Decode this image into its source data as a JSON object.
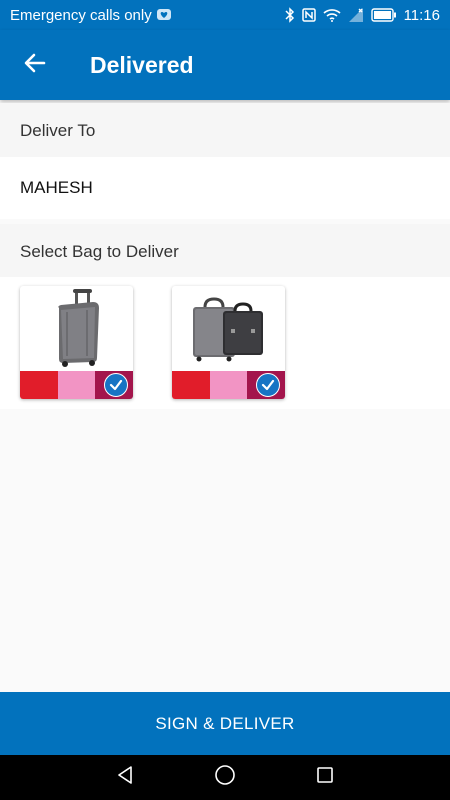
{
  "status_bar": {
    "carrier_text": "Emergency calls only",
    "time": "11:16",
    "icons": [
      "notification-icon",
      "bluetooth-icon",
      "nfc-icon",
      "wifi-icon",
      "signal-icon",
      "battery-icon"
    ]
  },
  "app_bar": {
    "back_icon": "arrow-left-icon",
    "title": "Delivered"
  },
  "deliver_to": {
    "label": "Deliver To",
    "value": "MAHESH"
  },
  "bag_section": {
    "label": "Select Bag to Deliver",
    "bags": [
      {
        "type": "rolling-suitcase",
        "colors": [
          "#e11d2a",
          "#f294c4",
          "#a3154c"
        ],
        "selected": true
      },
      {
        "type": "luggage-set",
        "colors": [
          "#e11d2a",
          "#f294c4",
          "#a3154c"
        ],
        "selected": true
      }
    ]
  },
  "actions": {
    "primary_label": "SIGN & DELIVER"
  },
  "nav_bar": {
    "buttons": [
      "back-triangle-icon",
      "home-circle-icon",
      "recents-square-icon"
    ]
  },
  "colors": {
    "primary": "#0272bd",
    "check": "#1774c4",
    "background": "#fafafa"
  }
}
